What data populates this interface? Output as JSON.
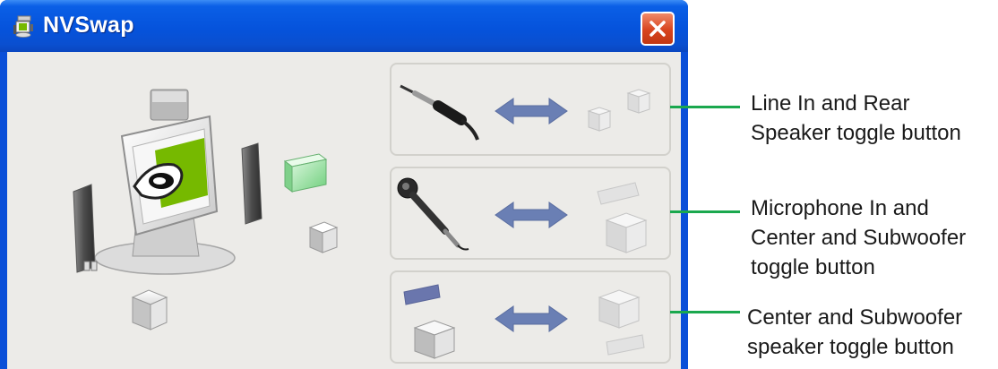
{
  "window": {
    "title": "NVSwap",
    "app_icon": "nvswap-app-icon",
    "close_icon": "close-icon"
  },
  "illustration": {
    "icons": [
      "monitor-icon",
      "nvidia-logo",
      "speaker-icon",
      "subwoofer-icon"
    ]
  },
  "toggles": [
    {
      "left_icon": "line-in-plug-icon",
      "arrow_icon": "double-arrow-icon",
      "right_icon": "rear-speakers-icon"
    },
    {
      "left_icon": "microphone-icon",
      "arrow_icon": "double-arrow-icon",
      "right_icon": "center-subwoofer-icon"
    },
    {
      "left_icon": "center-subwoofer-icon",
      "arrow_icon": "double-arrow-icon",
      "right_icon": "center-subwoofer-icon"
    }
  ],
  "callouts": [
    {
      "line1": "Line In and Rear",
      "line2": "Speaker toggle button"
    },
    {
      "line1": "Microphone In and",
      "line2": "Center and Subwoofer",
      "line3": "toggle button"
    },
    {
      "line1": "Center and Subwoofer",
      "line2": "speaker toggle button"
    }
  ],
  "colors": {
    "callout_line": "#1aa84e",
    "titlebar": "#0553dc",
    "close_button": "#d8441e",
    "client_bg": "#ecebe8"
  }
}
